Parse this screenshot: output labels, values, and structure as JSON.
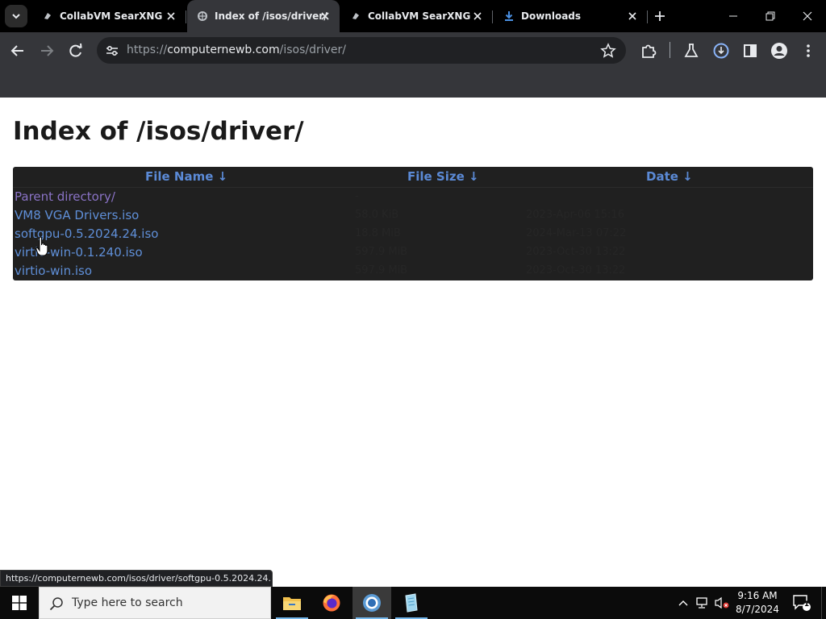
{
  "browser": {
    "tabs": [
      {
        "title": "CollabVM SearXNG",
        "icon": "searxng-favicon",
        "active": false
      },
      {
        "title": "Index of /isos/driver/",
        "icon": "searxng-favicon",
        "active": true
      },
      {
        "title": "CollabVM SearXNG",
        "icon": "searxng-favicon",
        "active": false
      },
      {
        "title": "Downloads",
        "icon": "download-icon",
        "active": false
      }
    ],
    "address": {
      "scheme": "https://",
      "host": "computernewb.com",
      "path": "/isos/driver/"
    },
    "status_url": "https://computernewb.com/isos/driver/softgpu-0.5.2024.24.i..."
  },
  "page": {
    "heading": "Index of /isos/driver/",
    "columns": [
      "File Name  ↓",
      "File Size  ↓",
      "Date  ↓"
    ],
    "rows": [
      {
        "name": "Parent directory/",
        "size": "-",
        "date": "",
        "visited": true
      },
      {
        "name": "VM8 VGA Drivers.iso",
        "size": "58.0 KiB",
        "date": "2023-Apr-06 15:16",
        "visited": false
      },
      {
        "name": "softgpu-0.5.2024.24.iso",
        "size": "18.8 MiB",
        "date": "2024-Mar-13 07:22",
        "visited": false
      },
      {
        "name": "virtio-win-0.1.240.iso",
        "size": "597.9 MiB",
        "date": "2023-Oct-30 13:22",
        "visited": false
      },
      {
        "name": "virtio-win.iso",
        "size": "597.9 MiB",
        "date": "2023-Oct-30 13:22",
        "visited": false
      }
    ]
  },
  "taskbar": {
    "search_placeholder": "Type here to search",
    "apps": [
      "file-explorer-icon",
      "firefox-icon",
      "chrome-icon",
      "notepad-icon"
    ],
    "time": "9:16 AM",
    "date": "8/7/2024",
    "notification_count": "1"
  }
}
